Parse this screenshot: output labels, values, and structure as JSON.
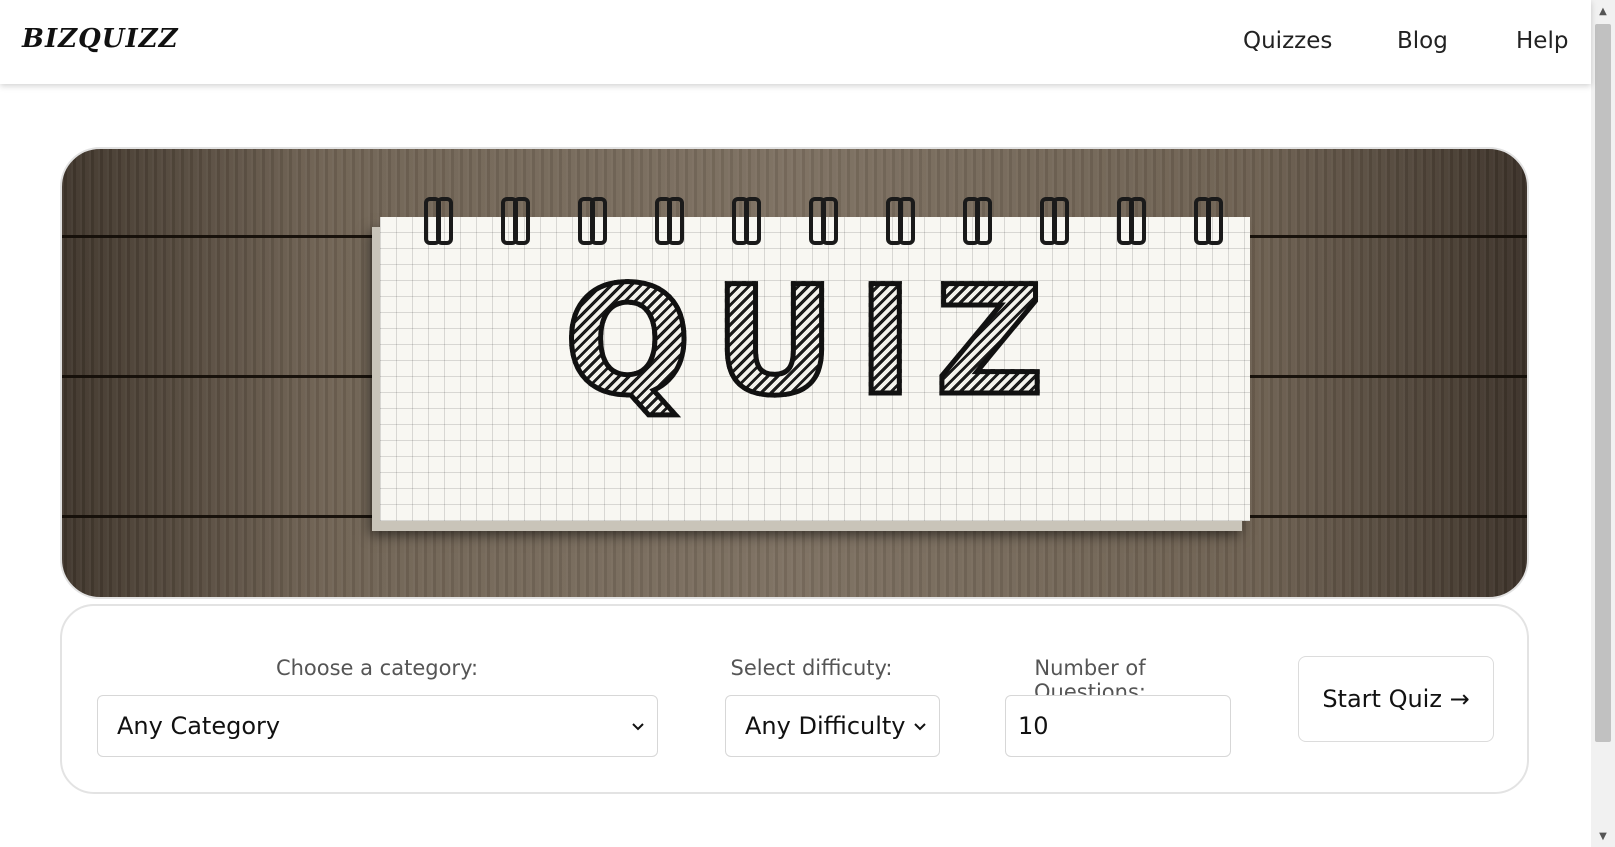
{
  "brand": {
    "logo": "BIZQUIZZ"
  },
  "nav": {
    "items": [
      "Quizzes",
      "Blog",
      "Help"
    ]
  },
  "hero": {
    "image_text": "QUIZ"
  },
  "form": {
    "category": {
      "label": "Choose a category:",
      "selected": "Any Category"
    },
    "difficulty": {
      "label": "Select difficuty:",
      "selected": "Any Difficulty"
    },
    "count": {
      "label": "Number of Questions:",
      "value": "10"
    },
    "start_label": "Start Quiz →"
  },
  "icons": {
    "select_chevron": "chevron-down-icon",
    "scroll_up": "arrow-up-icon",
    "scroll_down": "arrow-down-icon"
  }
}
